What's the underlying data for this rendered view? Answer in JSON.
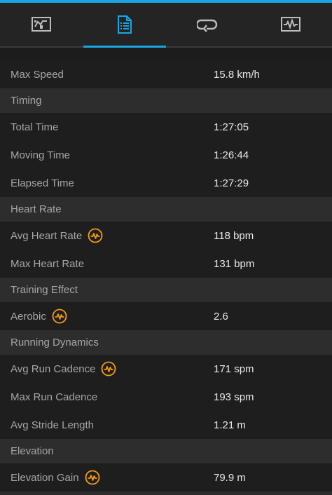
{
  "colors": {
    "accent": "#1aa6e4",
    "icon_orange": "#f59b1c",
    "label_text": "#a6a6a6",
    "value_text": "#e8e8e8",
    "section_bg": "#2d2d2d",
    "row_bg": "#1e1e1e"
  },
  "tabs": [
    {
      "icon": "overview-map-icon",
      "active": false
    },
    {
      "icon": "details-list-icon",
      "active": true
    },
    {
      "icon": "laps-loop-icon",
      "active": false
    },
    {
      "icon": "chart-icon",
      "active": false
    }
  ],
  "rows": {
    "max_speed": {
      "label": "Max Speed",
      "value": "15.8 km/h"
    },
    "timing_header": "Timing",
    "total_time": {
      "label": "Total Time",
      "value": "1:27:05"
    },
    "moving_time": {
      "label": "Moving Time",
      "value": "1:26:44"
    },
    "elapsed_time": {
      "label": "Elapsed Time",
      "value": "1:27:29"
    },
    "heart_rate_header": "Heart Rate",
    "avg_heart_rate": {
      "label": "Avg Heart Rate",
      "value": "118 bpm",
      "icon": "heart-rate-icon"
    },
    "max_heart_rate": {
      "label": "Max Heart Rate",
      "value": "131 bpm"
    },
    "training_effect_header": "Training Effect",
    "aerobic": {
      "label": "Aerobic",
      "value": "2.6",
      "icon": "heart-rate-icon"
    },
    "running_dynamics_header": "Running Dynamics",
    "avg_run_cadence": {
      "label": "Avg Run Cadence",
      "value": "171 spm",
      "icon": "heart-rate-icon"
    },
    "max_run_cadence": {
      "label": "Max Run Cadence",
      "value": "193 spm"
    },
    "avg_stride_length": {
      "label": "Avg Stride Length",
      "value": "1.21 m"
    },
    "elevation_header": "Elevation",
    "elevation_gain": {
      "label": "Elevation Gain",
      "value": "79.9 m",
      "icon": "heart-rate-icon"
    }
  }
}
